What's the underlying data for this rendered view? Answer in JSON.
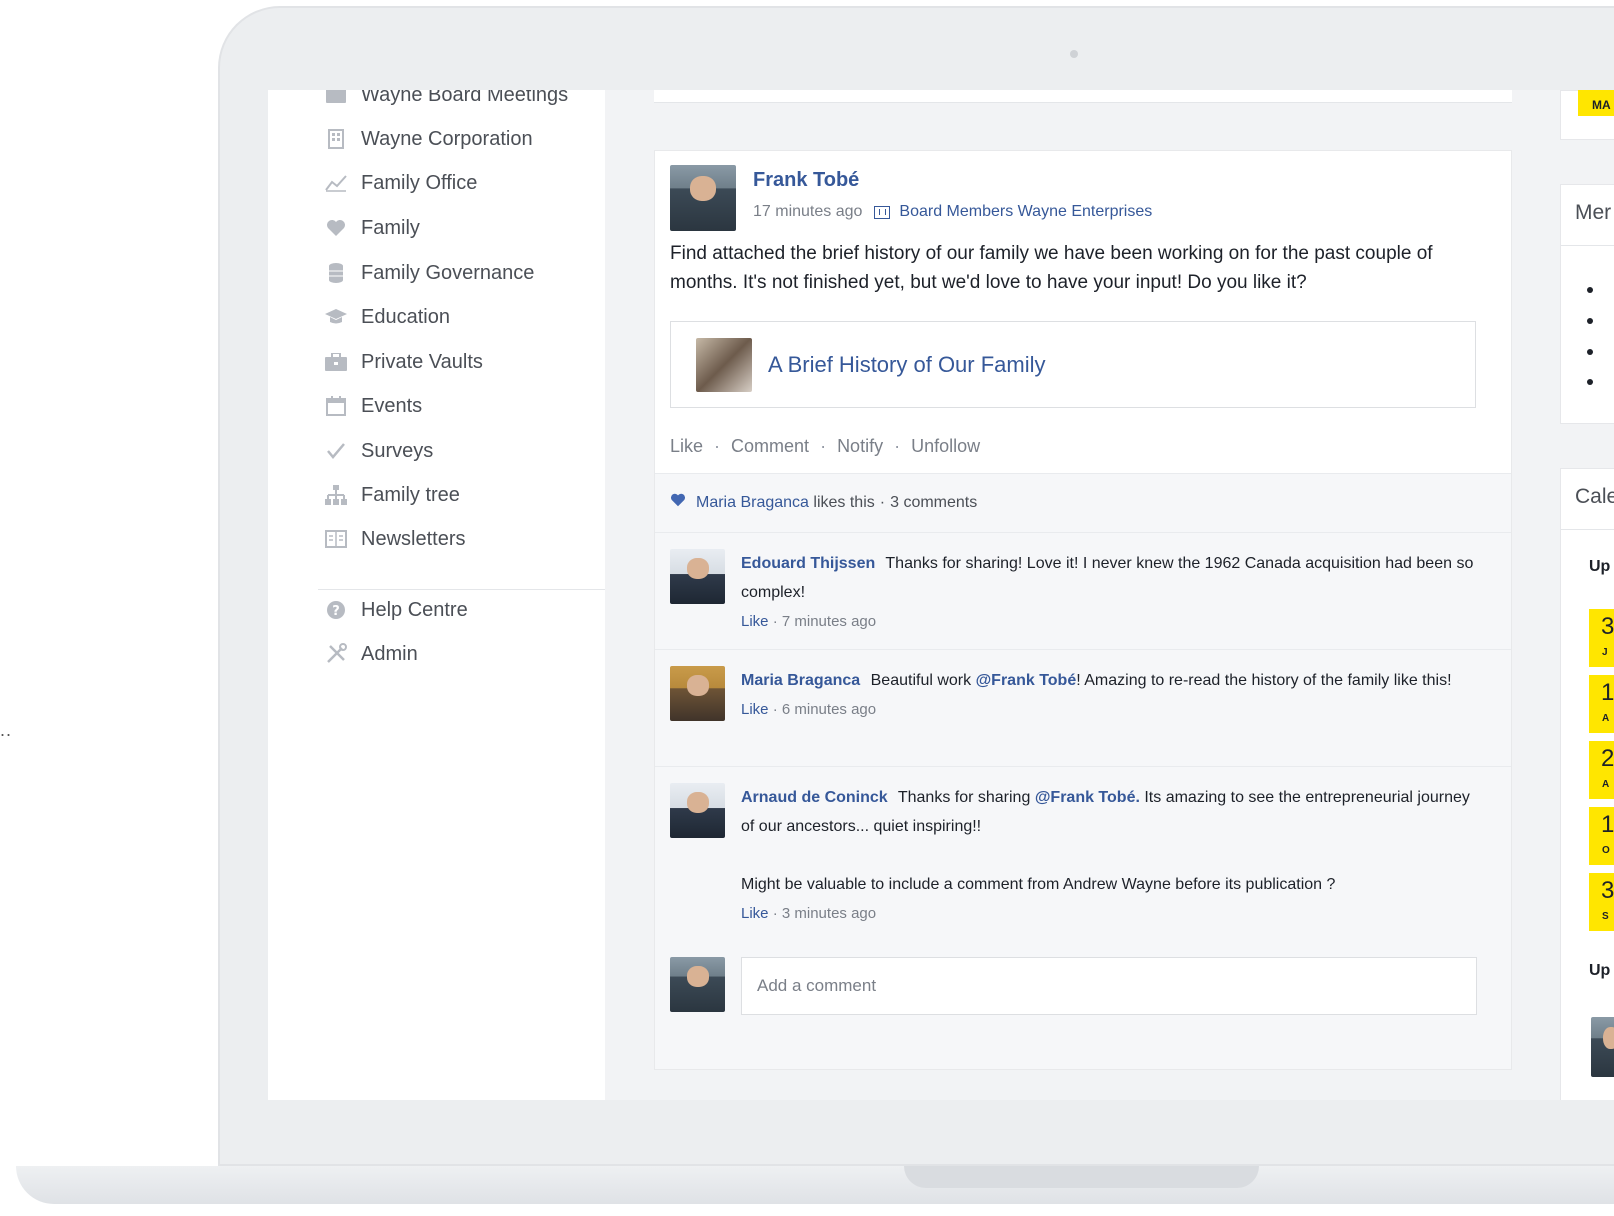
{
  "sidebar": {
    "items": [
      {
        "label": "Wayne Board Meetings",
        "icon": "folder-icon"
      },
      {
        "label": "Wayne Corporation",
        "icon": "building-icon"
      },
      {
        "label": "Family Office",
        "icon": "chart-line-icon"
      },
      {
        "label": "Family",
        "icon": "heart-icon"
      },
      {
        "label": "Family Governance",
        "icon": "database-icon"
      },
      {
        "label": "Education",
        "icon": "graduation-cap-icon"
      },
      {
        "label": "Private Vaults",
        "icon": "briefcase-icon"
      },
      {
        "label": "Events",
        "icon": "calendar-icon"
      },
      {
        "label": "Surveys",
        "icon": "checkmark-icon"
      },
      {
        "label": "Family tree",
        "icon": "sitemap-icon"
      },
      {
        "label": "Newsletters",
        "icon": "newspaper-icon"
      }
    ],
    "footer_items": [
      {
        "label": "Help Centre",
        "icon": "question-icon"
      },
      {
        "label": "Admin",
        "icon": "tools-icon"
      }
    ]
  },
  "post": {
    "author": "Frank Tobé",
    "time": "17 minutes ago",
    "group": "Board Members Wayne Enterprises",
    "text": "Find attached the brief history of our family we have been working on for the past couple of months. It's not finished yet, but we'd love to have your input! Do you like it?",
    "attachment_title": "A Brief History of Our Family",
    "actions": {
      "like": "Like",
      "comment": "Comment",
      "notify": "Notify",
      "unfollow": "Unfollow"
    },
    "likes": {
      "name": "Maria Braganca",
      "suffix": "likes this",
      "comments": "3 comments"
    }
  },
  "comments": [
    {
      "author": "Edouard Thijssen",
      "text": "Thanks for sharing! Love it! I never knew the 1962 Canada acquisition had been so complex!",
      "like": "Like",
      "time": "7 minutes ago"
    },
    {
      "author": "Maria Braganca",
      "text_before": "Beautiful work",
      "mention": "@Frank Tobé",
      "text_after": "! Amazing to re-read the history of the family like this!",
      "like": "Like",
      "time": "6 minutes ago"
    },
    {
      "author": "Arnaud de Coninck",
      "text_before": "Thanks for sharing",
      "mention": "@Frank Tobé.",
      "text_after": "Its amazing to see the entrepreneurial journey of our ancestors... quiet inspiring!!",
      "text_second": "Might be valuable to include a comment from Andrew Wayne before its publication ?",
      "like": "Like",
      "time": "3 minutes ago"
    }
  ],
  "compose": {
    "placeholder": "Add a comment"
  },
  "right": {
    "mar_badge": "MA",
    "members_title": "Mer",
    "calendar_title": "Cale",
    "upcoming_label_1": "Up",
    "upcoming_label_2": "Up",
    "dates": [
      {
        "day": "3",
        "mon": "J"
      },
      {
        "day": "1",
        "mon": "A"
      },
      {
        "day": "2",
        "mon": "A"
      },
      {
        "day": "1",
        "mon": "O"
      },
      {
        "day": "3",
        "mon": "S"
      }
    ]
  },
  "left_overflow": "..",
  "colors": {
    "link": "#365899",
    "accent_yellow": "#ffe600",
    "heart": "#4267b2"
  }
}
